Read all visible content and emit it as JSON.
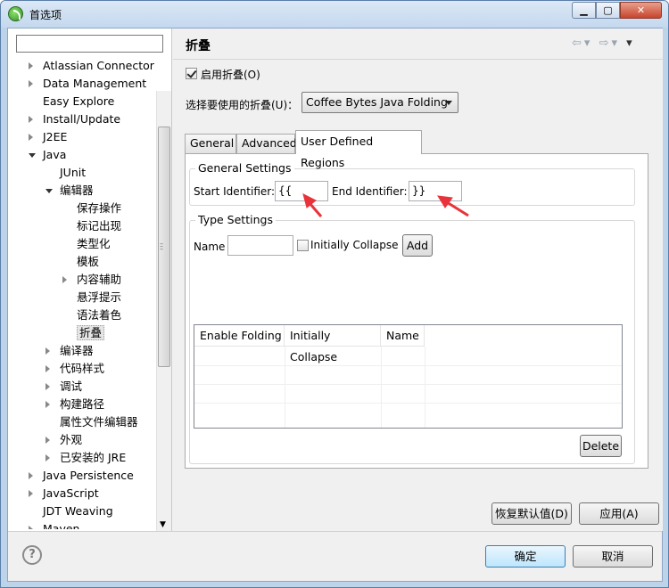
{
  "window": {
    "title": "首选项"
  },
  "tree": {
    "items": [
      {
        "label": "Atlassian Connector",
        "level": 0,
        "expandable": true,
        "expanded": false
      },
      {
        "label": "Data Management",
        "level": 0,
        "expandable": true,
        "expanded": false
      },
      {
        "label": "Easy Explore",
        "level": 0,
        "expandable": false,
        "expanded": false
      },
      {
        "label": "Install/Update",
        "level": 0,
        "expandable": true,
        "expanded": false
      },
      {
        "label": "J2EE",
        "level": 0,
        "expandable": true,
        "expanded": false
      },
      {
        "label": "Java",
        "level": 0,
        "expandable": true,
        "expanded": true
      },
      {
        "label": "JUnit",
        "level": 1,
        "expandable": false,
        "expanded": false
      },
      {
        "label": "编辑器",
        "level": 1,
        "expandable": true,
        "expanded": true
      },
      {
        "label": "保存操作",
        "level": 2,
        "expandable": false,
        "expanded": false
      },
      {
        "label": "标记出现",
        "level": 2,
        "expandable": false,
        "expanded": false
      },
      {
        "label": "类型化",
        "level": 2,
        "expandable": false,
        "expanded": false
      },
      {
        "label": "模板",
        "level": 2,
        "expandable": false,
        "expanded": false
      },
      {
        "label": "内容辅助",
        "level": 2,
        "expandable": true,
        "expanded": false
      },
      {
        "label": "悬浮提示",
        "level": 2,
        "expandable": false,
        "expanded": false
      },
      {
        "label": "语法着色",
        "level": 2,
        "expandable": false,
        "expanded": false
      },
      {
        "label": "折叠",
        "level": 2,
        "expandable": false,
        "expanded": false,
        "selected": true
      },
      {
        "label": "编译器",
        "level": 1,
        "expandable": true,
        "expanded": false
      },
      {
        "label": "代码样式",
        "level": 1,
        "expandable": true,
        "expanded": false
      },
      {
        "label": "调试",
        "level": 1,
        "expandable": true,
        "expanded": false
      },
      {
        "label": "构建路径",
        "level": 1,
        "expandable": true,
        "expanded": false
      },
      {
        "label": "属性文件编辑器",
        "level": 1,
        "expandable": false,
        "expanded": false
      },
      {
        "label": "外观",
        "level": 1,
        "expandable": true,
        "expanded": false
      },
      {
        "label": "已安装的 JRE",
        "level": 1,
        "expandable": true,
        "expanded": false
      },
      {
        "label": "Java Persistence",
        "level": 0,
        "expandable": true,
        "expanded": false
      },
      {
        "label": "JavaScript",
        "level": 0,
        "expandable": true,
        "expanded": false
      },
      {
        "label": "JDT Weaving",
        "level": 0,
        "expandable": false,
        "expanded": false
      },
      {
        "label": "Maven",
        "level": 0,
        "expandable": true,
        "expanded": false
      }
    ]
  },
  "page": {
    "title": "折叠",
    "enable_folding_label": "启用折叠(O)",
    "enable_folding_checked": true,
    "select_folding_label": "选择要使用的折叠(U)：",
    "folding_selected": "Coffee Bytes Java Folding"
  },
  "tabs": [
    {
      "label": "General",
      "active": false
    },
    {
      "label": "Advanced",
      "active": false
    },
    {
      "label": "User Defined Regions",
      "active": true
    }
  ],
  "general_settings": {
    "title": "General Settings",
    "start_label": "Start Identifier:",
    "start_value": "{{",
    "end_label": "End Identifier:",
    "end_value": "}}"
  },
  "type_settings": {
    "title": "Type Settings",
    "name_label": "Name",
    "initially_collapse_label": "Initially Collapse",
    "initially_collapse_checked": false,
    "add_label": "Add"
  },
  "table": {
    "columns": [
      "Enable Folding",
      "Initially Collapse",
      "Name"
    ]
  },
  "buttons": {
    "delete": "Delete",
    "restore_defaults": "恢复默认值(D)",
    "apply": "应用(A)",
    "ok": "确定",
    "cancel": "取消"
  },
  "colors": {
    "accent_arrow": "#e8333a",
    "default_button": "#3c7fb1"
  }
}
